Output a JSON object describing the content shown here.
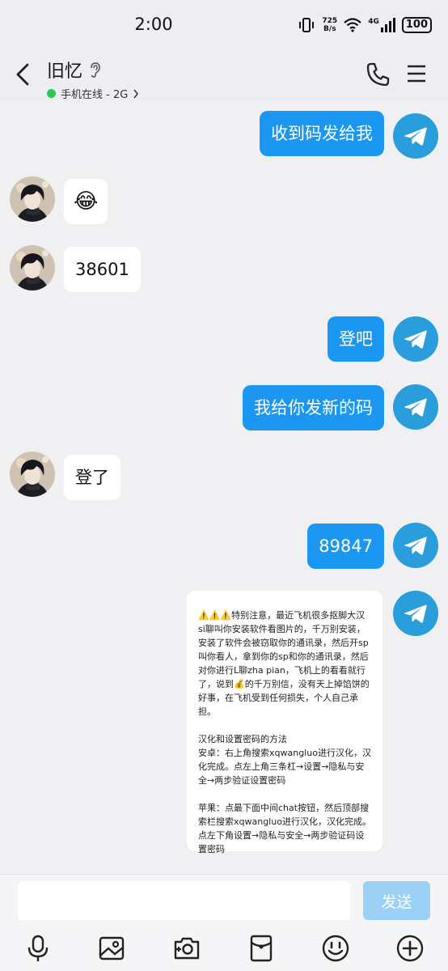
{
  "status_bar": {
    "time": "2:00",
    "net_speed_value": "725",
    "net_speed_unit": "B/s",
    "signal_label": "4G",
    "battery": "100"
  },
  "header": {
    "title": "旧忆",
    "subtitle": "手机在线 - 2G"
  },
  "messages": [
    {
      "dir": "out",
      "text": "收到码发给我"
    },
    {
      "dir": "in",
      "text": "😂"
    },
    {
      "dir": "in",
      "text": "38601"
    },
    {
      "dir": "out",
      "text": "登吧"
    },
    {
      "dir": "out",
      "text": "我给你发新的码"
    },
    {
      "dir": "in",
      "text": "登了"
    },
    {
      "dir": "out",
      "text": "89847"
    }
  ],
  "notice": {
    "p1": "⚠️⚠️⚠️特别注意，最近飞机很多抠脚大汉si聊叫你安装软件看图片的，千万别安装，安装了软件会被窃取你的通讯录，然后开sp叫你看人，拿到你的sp和你的通讯录，然后对你进行L聊zha pian，飞机上的看看就行了，说到💰的千万别信，没有天上掉馅饼的好事，在飞机受到任何损失，个人自己承担。",
    "p2": "汉化和设置密码的方法\n安卓：右上角搜索xqwangluo进行汉化，汉化完成。点左上角三条杠→设置→隐私与安全→两步验证设置密码",
    "p3": "苹果：点最下面中间chat按钮，然后顶部搜索栏搜索xqwangluo进行汉化，汉化完成。点左下角设置→隐私与安全→两步验证码设置密码"
  },
  "input": {
    "placeholder": "",
    "send_label": "发送"
  },
  "colors": {
    "bubble_out": "#1b97f1",
    "send_disabled": "#9bd0f7",
    "telegram": "#2a9ddc",
    "online": "#2dc84d"
  }
}
